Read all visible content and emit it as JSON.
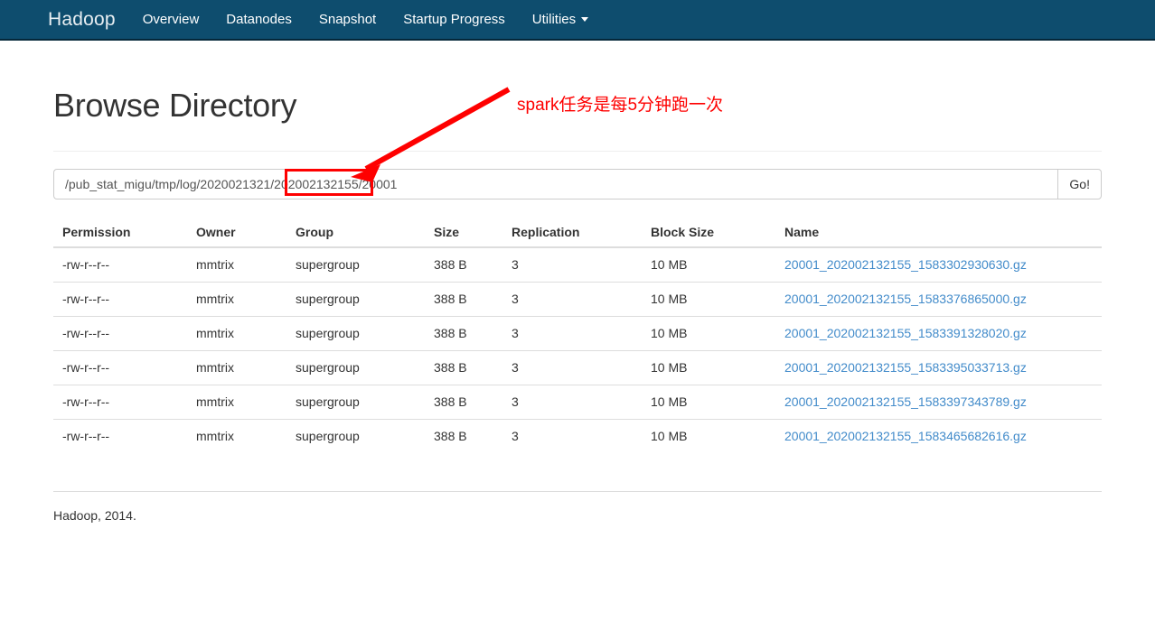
{
  "navbar": {
    "brand": "Hadoop",
    "items": [
      {
        "label": "Overview",
        "icon": ""
      },
      {
        "label": "Datanodes",
        "icon": ""
      },
      {
        "label": "Snapshot",
        "icon": ""
      },
      {
        "label": "Startup Progress",
        "icon": ""
      },
      {
        "label": "Utilities",
        "icon": "caret-down-icon"
      }
    ],
    "background_color": "#0e4d6e"
  },
  "page": {
    "title": "Browse Directory"
  },
  "path_form": {
    "value": "/pub_stat_migu/tmp/log/2020021321/202002132155/20001",
    "placeholder": "Enter path",
    "go_label": "Go!"
  },
  "table": {
    "headers": [
      "Permission",
      "Owner",
      "Group",
      "Size",
      "Replication",
      "Block Size",
      "Name"
    ],
    "rows": [
      {
        "permission": "-rw-r--r--",
        "owner": "mmtrix",
        "group": "supergroup",
        "size": "388 B",
        "replication": "3",
        "block_size": "10 MB",
        "name": "20001_202002132155_1583302930630.gz"
      },
      {
        "permission": "-rw-r--r--",
        "owner": "mmtrix",
        "group": "supergroup",
        "size": "388 B",
        "replication": "3",
        "block_size": "10 MB",
        "name": "20001_202002132155_1583376865000.gz"
      },
      {
        "permission": "-rw-r--r--",
        "owner": "mmtrix",
        "group": "supergroup",
        "size": "388 B",
        "replication": "3",
        "block_size": "10 MB",
        "name": "20001_202002132155_1583391328020.gz"
      },
      {
        "permission": "-rw-r--r--",
        "owner": "mmtrix",
        "group": "supergroup",
        "size": "388 B",
        "replication": "3",
        "block_size": "10 MB",
        "name": "20001_202002132155_1583395033713.gz"
      },
      {
        "permission": "-rw-r--r--",
        "owner": "mmtrix",
        "group": "supergroup",
        "size": "388 B",
        "replication": "3",
        "block_size": "10 MB",
        "name": "20001_202002132155_1583397343789.gz"
      },
      {
        "permission": "-rw-r--r--",
        "owner": "mmtrix",
        "group": "supergroup",
        "size": "388 B",
        "replication": "3",
        "block_size": "10 MB",
        "name": "20001_202002132155_1583465682616.gz"
      }
    ]
  },
  "footer": {
    "text": "Hadoop, 2014."
  },
  "annotation": {
    "text": "spark任务是每5分钟跑一次",
    "color": "#fe0000",
    "highlighted_segment": "202002132155"
  }
}
